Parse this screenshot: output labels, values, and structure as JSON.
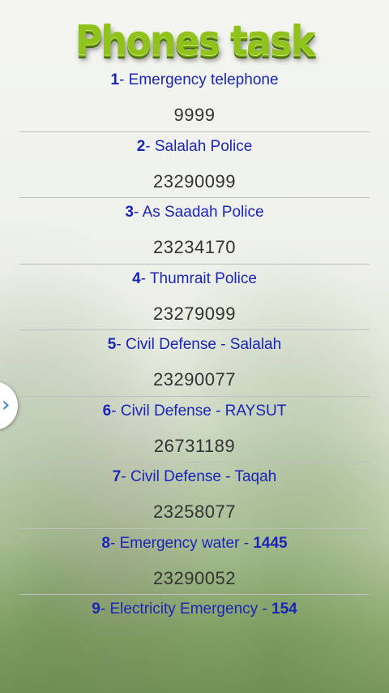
{
  "title": "Phones task",
  "items": [
    {
      "num": "1",
      "sep": "- ",
      "label": "Emergency telephone",
      "extra": "",
      "phone": "9999"
    },
    {
      "num": "2",
      "sep": "- ",
      "label": "Salalah Police",
      "extra": "",
      "phone": "23290099"
    },
    {
      "num": "3",
      "sep": "- ",
      "label": "As Saadah Police",
      "extra": "",
      "phone": "23234170"
    },
    {
      "num": "4",
      "sep": "- ",
      "label": "Thumrait  Police",
      "extra": "",
      "phone": "23279099"
    },
    {
      "num": "5",
      "sep": "- ",
      "label": "Civil Defense - Salalah",
      "extra": "",
      "phone": "23290077"
    },
    {
      "num": "6",
      "sep": "- ",
      "label": "Civil Defense - RAYSUT",
      "extra": "",
      "phone": "26731189"
    },
    {
      "num": "7",
      "sep": "- ",
      "label": "Civil Defense - Taqah",
      "extra": "",
      "phone": "23258077"
    },
    {
      "num": "8",
      "sep": "- ",
      "label": "Emergency water - ",
      "extra": "1445",
      "phone": "23290052"
    },
    {
      "num": "9",
      "sep": "- ",
      "label": "Electricity Emergency - ",
      "extra": "154",
      "phone": ""
    }
  ],
  "side_tab": {
    "icon": "chevron-right-icon",
    "glyph": "›"
  }
}
